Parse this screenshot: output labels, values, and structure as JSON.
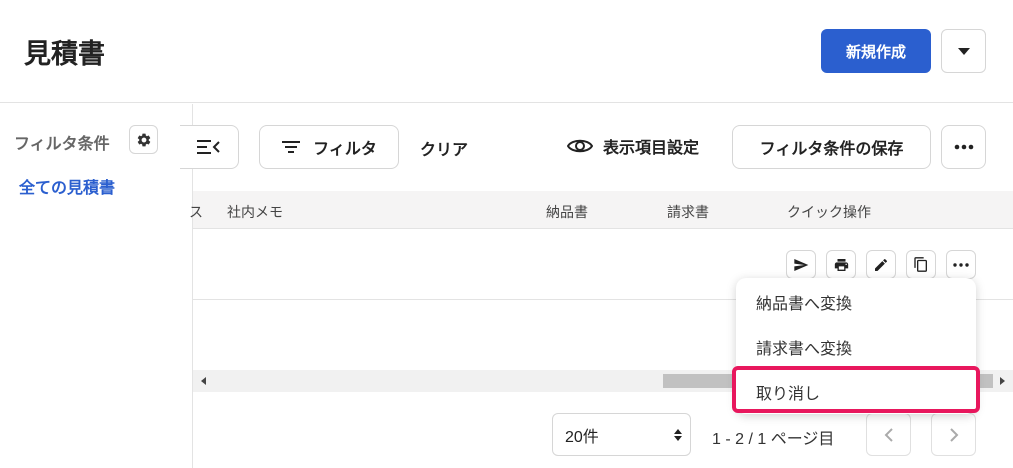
{
  "header": {
    "title": "見積書",
    "new_button": "新規作成"
  },
  "sidebar": {
    "filter_label": "フィルタ条件",
    "active_view": "全ての見積書"
  },
  "toolbar": {
    "filter_button": "フィルタ",
    "clear_label": "クリア",
    "display_settings": "表示項目設定",
    "save_filter_button": "フィルタ条件の保存"
  },
  "table": {
    "partial_column": "ス",
    "columns": [
      "社内メモ",
      "納品書",
      "請求書",
      "クイック操作"
    ]
  },
  "quick_actions": [
    "send-icon",
    "print-icon",
    "edit-icon",
    "copy-icon",
    "more-icon"
  ],
  "menu": {
    "items": [
      "納品書へ変換",
      "請求書へ変換",
      "取り消し"
    ],
    "highlight_color": "#e8175d"
  },
  "pagination": {
    "per_page": "20件",
    "info": "1 - 2 / 1 ページ目"
  },
  "colors": {
    "accent": "#2b5fcf"
  }
}
